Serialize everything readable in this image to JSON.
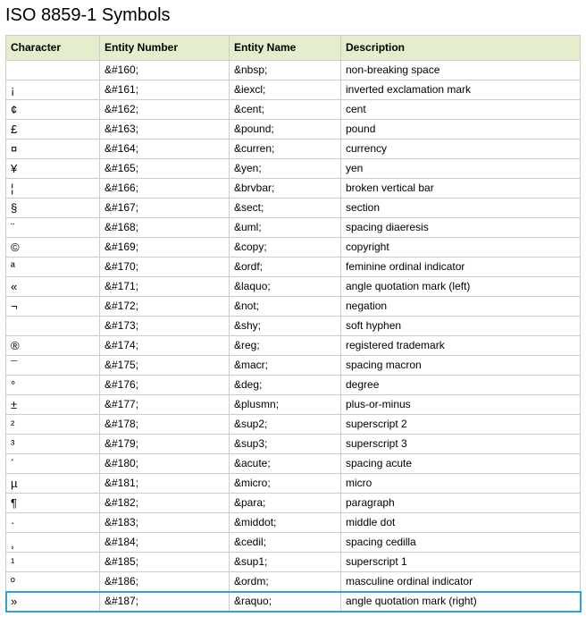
{
  "title": "ISO 8859-1 Symbols",
  "columns": [
    "Character",
    "Entity Number",
    "Entity Name",
    "Description"
  ],
  "rows": [
    {
      "char": " ",
      "num": "&#160;",
      "name": "&nbsp;",
      "desc": "non-breaking space"
    },
    {
      "char": "¡",
      "num": "&#161;",
      "name": "&iexcl;",
      "desc": "inverted exclamation mark"
    },
    {
      "char": "¢",
      "num": "&#162;",
      "name": "&cent;",
      "desc": "cent"
    },
    {
      "char": "£",
      "num": "&#163;",
      "name": "&pound;",
      "desc": "pound"
    },
    {
      "char": "¤",
      "num": "&#164;",
      "name": "&curren;",
      "desc": "currency"
    },
    {
      "char": "¥",
      "num": "&#165;",
      "name": "&yen;",
      "desc": "yen"
    },
    {
      "char": "¦",
      "num": "&#166;",
      "name": "&brvbar;",
      "desc": "broken vertical bar"
    },
    {
      "char": "§",
      "num": "&#167;",
      "name": "&sect;",
      "desc": "section"
    },
    {
      "char": "¨",
      "num": "&#168;",
      "name": "&uml;",
      "desc": "spacing diaeresis"
    },
    {
      "char": "©",
      "num": "&#169;",
      "name": "&copy;",
      "desc": "copyright"
    },
    {
      "char": "ª",
      "num": "&#170;",
      "name": "&ordf;",
      "desc": "feminine ordinal indicator"
    },
    {
      "char": "«",
      "num": "&#171;",
      "name": "&laquo;",
      "desc": "angle quotation mark (left)"
    },
    {
      "char": "¬",
      "num": "&#172;",
      "name": "&not;",
      "desc": "negation"
    },
    {
      "char": "",
      "num": "&#173;",
      "name": "&shy;",
      "desc": "soft hyphen"
    },
    {
      "char": "®",
      "num": "&#174;",
      "name": "&reg;",
      "desc": "registered trademark"
    },
    {
      "char": "¯",
      "num": "&#175;",
      "name": "&macr;",
      "desc": "spacing macron"
    },
    {
      "char": "°",
      "num": "&#176;",
      "name": "&deg;",
      "desc": "degree"
    },
    {
      "char": "±",
      "num": "&#177;",
      "name": "&plusmn;",
      "desc": "plus-or-minus"
    },
    {
      "char": "²",
      "num": "&#178;",
      "name": "&sup2;",
      "desc": "superscript 2"
    },
    {
      "char": "³",
      "num": "&#179;",
      "name": "&sup3;",
      "desc": "superscript 3"
    },
    {
      "char": "´",
      "num": "&#180;",
      "name": "&acute;",
      "desc": "spacing acute"
    },
    {
      "char": "µ",
      "num": "&#181;",
      "name": "&micro;",
      "desc": "micro"
    },
    {
      "char": "¶",
      "num": "&#182;",
      "name": "&para;",
      "desc": "paragraph"
    },
    {
      "char": "·",
      "num": "&#183;",
      "name": "&middot;",
      "desc": "middle dot"
    },
    {
      "char": "¸",
      "num": "&#184;",
      "name": "&cedil;",
      "desc": "spacing cedilla"
    },
    {
      "char": "¹",
      "num": "&#185;",
      "name": "&sup1;",
      "desc": "superscript 1"
    },
    {
      "char": "º",
      "num": "&#186;",
      "name": "&ordm;",
      "desc": "masculine ordinal indicator"
    },
    {
      "char": "»",
      "num": "&#187;",
      "name": "&raquo;",
      "desc": "angle quotation mark (right)",
      "highlight": true
    }
  ]
}
